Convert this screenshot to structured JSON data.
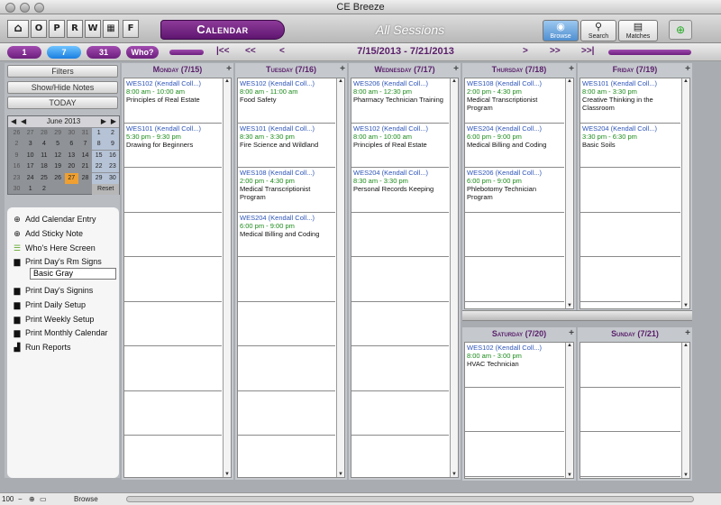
{
  "window": {
    "title": "CE Breeze"
  },
  "toolbar": {
    "home_label": "⌂",
    "letters": [
      "O",
      "P",
      "R",
      "W"
    ],
    "grid_label": "▦",
    "f_label": "F",
    "calendar_tab": "Calendar",
    "view_title": "All Sessions",
    "browse_label": "Browse",
    "search_label": "Search",
    "matches_label": "Matches"
  },
  "nav": {
    "view_1": "1",
    "view_7": "7",
    "view_31": "31",
    "who": "Who?",
    "first": "|<<",
    "prev2": "<<",
    "prev": "<",
    "next": ">",
    "next2": ">>",
    "last": ">>|",
    "date_range": "7/15/2013 - 7/21/2013"
  },
  "sidebar": {
    "filters": "Filters",
    "show_hide": "Show/Hide Notes",
    "today": "TODAY",
    "mini_cal": {
      "month": "June 2013",
      "weeks": [
        [
          "26",
          "27",
          "28",
          "29",
          "30",
          "31",
          "1",
          "2"
        ],
        [
          "2",
          "3",
          "4",
          "5",
          "6",
          "7",
          "8",
          "9"
        ],
        [
          "9",
          "10",
          "11",
          "12",
          "13",
          "14",
          "15",
          "16"
        ],
        [
          "16",
          "17",
          "18",
          "19",
          "20",
          "21",
          "22",
          "23"
        ],
        [
          "23",
          "24",
          "25",
          "26",
          "27",
          "28",
          "29",
          "30"
        ],
        [
          "30",
          "1",
          "2",
          "",
          "",
          "",
          "",
          "Reset"
        ]
      ]
    },
    "actions": [
      {
        "icon": "plus-circle",
        "label": "Add Calendar Entry"
      },
      {
        "icon": "plus-circle",
        "label": "Add Sticky Note"
      },
      {
        "icon": "list",
        "label": "Who's Here Screen"
      },
      {
        "icon": "printer",
        "label": "Print Day's Rm Signs"
      },
      {
        "icon": "printer",
        "label": "Print Day's Signins"
      },
      {
        "icon": "printer",
        "label": "Print Daily Setup"
      },
      {
        "icon": "printer",
        "label": "Print Weekly Setup"
      },
      {
        "icon": "printer",
        "label": "Print Monthly Calendar"
      },
      {
        "icon": "chart",
        "label": "Run Reports"
      }
    ],
    "sign_style": "Basic Gray"
  },
  "days": [
    {
      "label": "Monday (7/15)",
      "events": [
        {
          "course": "WES102 (Kendall Coll...)",
          "time": "8:00 am - 10:00 am",
          "name": "Principles of Real Estate"
        },
        {
          "course": "WES101 (Kendall Coll...)",
          "time": "5:30 pm - 9:30 pm",
          "name": "Drawing for Beginners"
        }
      ]
    },
    {
      "label": "Tuesday (7/16)",
      "events": [
        {
          "course": "WES102 (Kendall Coll...)",
          "time": "8:00 am - 11:00 am",
          "name": "Food Safety"
        },
        {
          "course": "WES101 (Kendall Coll...)",
          "time": "8:30 am - 3:30 pm",
          "name": "Fire Science and Wildland"
        },
        {
          "course": "WES108 (Kendall Coll...)",
          "time": "2:00 pm - 4:30 pm",
          "name": "Medical Transcriptionist Program"
        },
        {
          "course": "WES204 (Kendall Coll...)",
          "time": "6:00 pm - 9:00 pm",
          "name": "Medical Billing and Coding"
        }
      ]
    },
    {
      "label": "Wednesday (7/17)",
      "events": [
        {
          "course": "WES206 (Kendall Coll...)",
          "time": "8:00 am - 12:30 pm",
          "name": "Pharmacy Technician Training"
        },
        {
          "course": "WES102 (Kendall Coll...)",
          "time": "8:00 am - 10:00 am",
          "name": "Principles of Real Estate"
        },
        {
          "course": "WES204 (Kendall Coll...)",
          "time": "8:30 am - 3:30 pm",
          "name": "Personal Records Keeping"
        }
      ]
    },
    {
      "label": "Thursday (7/18)",
      "events": [
        {
          "course": "WES108 (Kendall Coll...)",
          "time": "2:00 pm - 4:30 pm",
          "name": "Medical Transcriptionist Program"
        },
        {
          "course": "WES204 (Kendall Coll...)",
          "time": "6:00 pm - 9:00 pm",
          "name": "Medical Billing and Coding"
        },
        {
          "course": "WES206 (Kendall Coll...)",
          "time": "6:00 pm - 9:00 pm",
          "name": "Phlebotomy Technician Program"
        }
      ]
    },
    {
      "label": "Friday (7/19)",
      "events": [
        {
          "course": "WES101 (Kendall Coll...)",
          "time": "8:00 am - 3:30 pm",
          "name": "Creative Thinking in the Classroom"
        },
        {
          "course": "WES204 (Kendall Coll...)",
          "time": "3:30 pm - 6:30 pm",
          "name": "Basic Soils"
        }
      ]
    },
    {
      "label": "Saturday (7/20)",
      "events": [
        {
          "course": "WES102 (Kendall Coll...)",
          "time": "8:00 am - 3:00 pm",
          "name": "HVAC Technician"
        }
      ]
    },
    {
      "label": "Sunday (7/21)",
      "events": []
    }
  ],
  "status": {
    "zoom": "100",
    "mode": "Browse"
  }
}
